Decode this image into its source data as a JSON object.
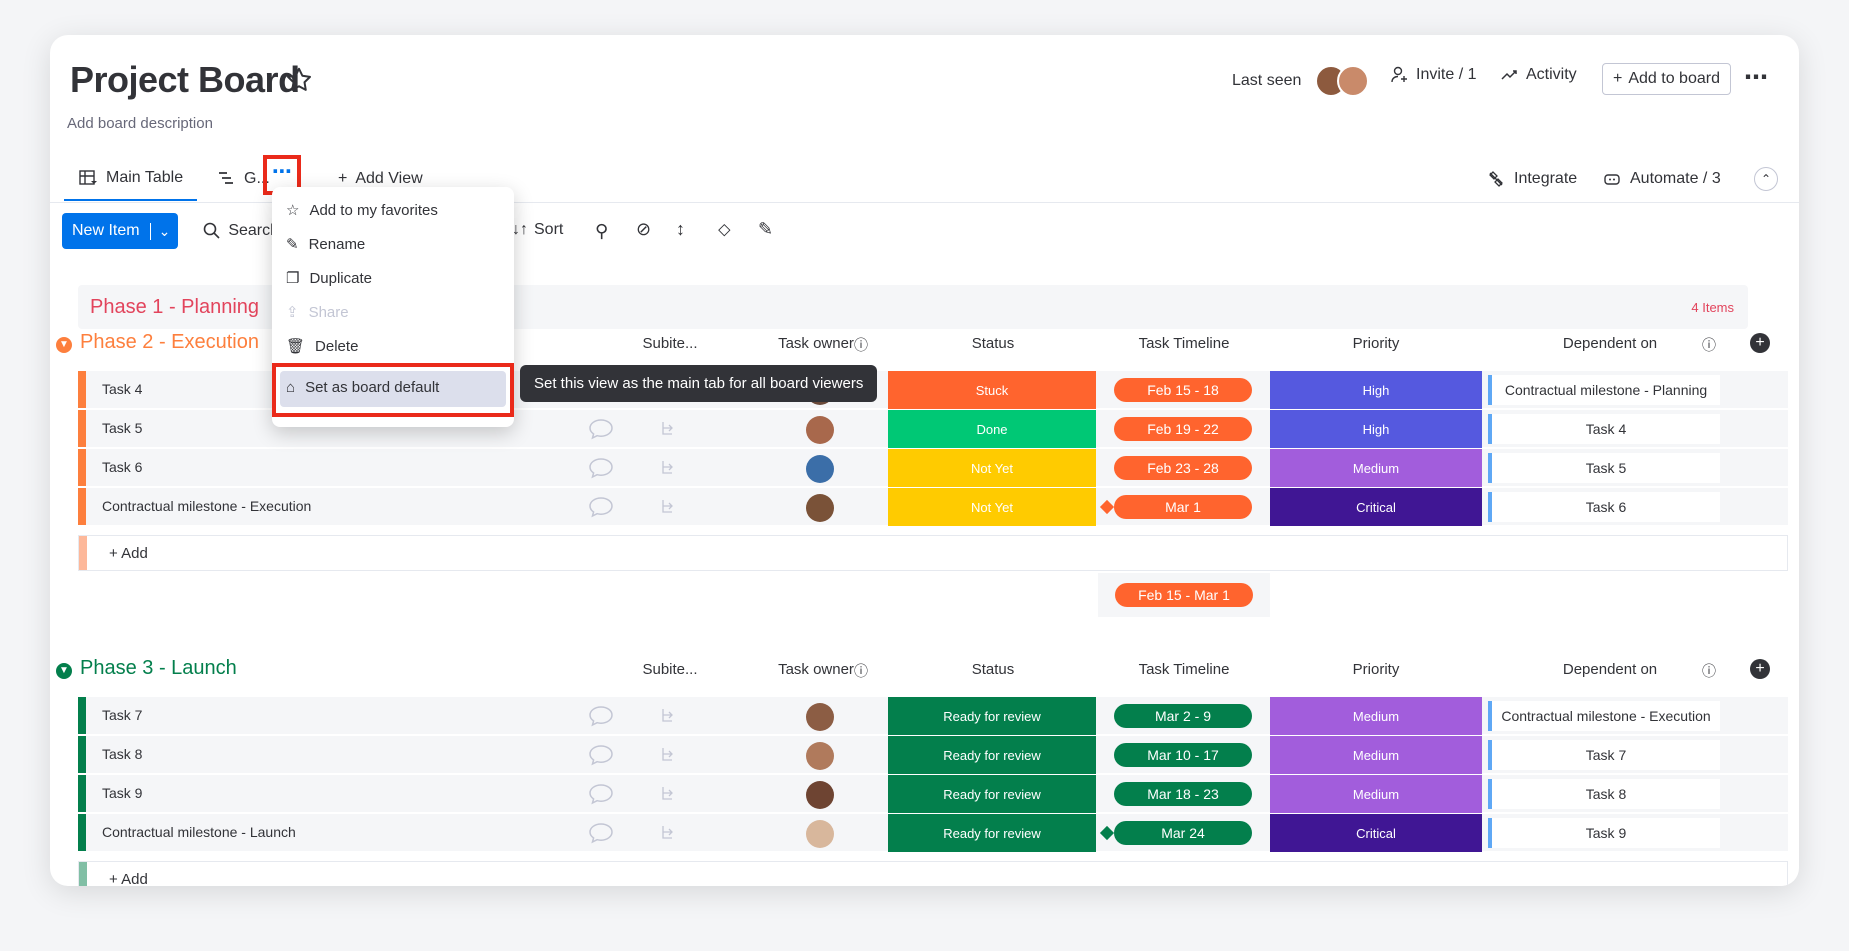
{
  "header": {
    "title": "Project Board",
    "description": "Add board description",
    "last_seen": "Last seen",
    "invite": "Invite / 1",
    "activity": "Activity",
    "add_to_board": "Add to board"
  },
  "tabs": {
    "main_table": "Main Table",
    "gantt": "G...",
    "add_view": "Add View",
    "integrate": "Integrate",
    "automate": "Automate / 3"
  },
  "toolbar": {
    "new_item": "New Item",
    "search": "Search",
    "sort": "Sort"
  },
  "menu": {
    "items": [
      "Add to my favorites",
      "Rename",
      "Duplicate",
      "Share",
      "Delete",
      "Set as board default"
    ]
  },
  "tooltip": "Set this view as the main tab for all board viewers",
  "columns": {
    "subitems": "Subite...",
    "owner": "Task owner",
    "status": "Status",
    "timeline": "Task Timeline",
    "priority": "Priority",
    "dependent": "Dependent on"
  },
  "phase1": {
    "title": "Phase 1 - Planning",
    "count": "4 Items"
  },
  "phase2": {
    "title": "Phase 2 - Execution",
    "rows": [
      {
        "name": "Task 4",
        "status": "Stuck",
        "timeline": "Feb 15 - 18",
        "priority": "High",
        "dependent": "Contractual milestone - Planning"
      },
      {
        "name": "Task 5",
        "status": "Done",
        "timeline": "Feb 19 - 22",
        "priority": "High",
        "dependent": "Task 4"
      },
      {
        "name": "Task 6",
        "status": "Not Yet",
        "timeline": "Feb 23 - 28",
        "priority": "Medium",
        "dependent": "Task 5"
      },
      {
        "name": "Contractual milestone - Execution",
        "status": "Not Yet",
        "timeline": "Mar 1",
        "priority": "Critical",
        "dependent": "Task 6"
      }
    ],
    "add": "+ Add",
    "summary": "Feb 15 - Mar 1"
  },
  "phase3": {
    "title": "Phase 3 - Launch",
    "rows": [
      {
        "name": "Task 7",
        "status": "Ready for review",
        "timeline": "Mar 2 - 9",
        "priority": "Medium",
        "dependent": "Contractual milestone - Execution"
      },
      {
        "name": "Task 8",
        "status": "Ready for review",
        "timeline": "Mar 10 - 17",
        "priority": "Medium",
        "dependent": "Task 7"
      },
      {
        "name": "Task 9",
        "status": "Ready for review",
        "timeline": "Mar 18 - 23",
        "priority": "Medium",
        "dependent": "Task 8"
      },
      {
        "name": "Contractual milestone - Launch",
        "status": "Ready for review",
        "timeline": "Mar 24",
        "priority": "Critical",
        "dependent": "Task 9"
      }
    ],
    "add": "+ Add"
  },
  "colors": {
    "stuck": "#ff642e",
    "done": "#00c875",
    "notyet": "#ffcb00",
    "ready": "#037f4c",
    "high": "#5559df",
    "medium": "#a25ddc",
    "critical": "#401694",
    "execution": "#fd7f3d",
    "launch": "#037f4c",
    "planning": "#e2445c",
    "accent": "#0073ea"
  }
}
